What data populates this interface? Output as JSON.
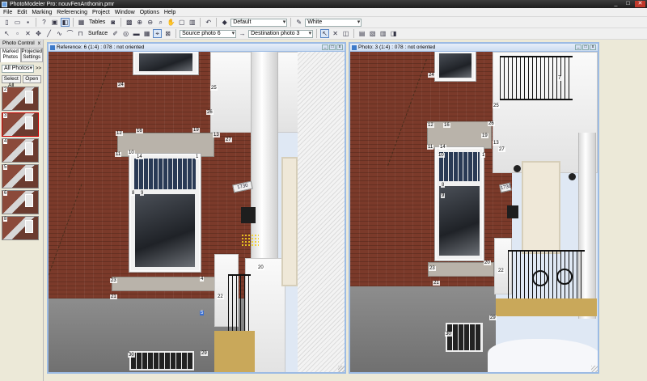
{
  "window": {
    "title": "PhotoModeler Pro: nouvFenAnthonin.pmr",
    "controls": [
      "_",
      "□",
      "✕"
    ]
  },
  "menu": [
    "File",
    "Edit",
    "Marking",
    "Referencing",
    "Project",
    "Window",
    "Options",
    "Help"
  ],
  "toolbar1": {
    "tables_label": "Tables",
    "default_combo": "Default",
    "white_combo": "White"
  },
  "toolbar2": {
    "surface_label": "Surface",
    "source_photo": "Source photo 6",
    "destination_photo": "Destination photo 3"
  },
  "left_panel": {
    "title": "Photo Control",
    "close": "x",
    "tabs": [
      "Marked Photos",
      "Projected Settings"
    ],
    "filter": "All Photos",
    "filter_arrow": ">>",
    "buttons": [
      "Select All",
      "Open"
    ],
    "thumbnails": [
      "2",
      "3",
      "4",
      "5",
      "6",
      "8"
    ]
  },
  "photo_left": {
    "title": "Reference: 6 (1:4) : 078 : not oriented",
    "plaque": "1730",
    "points": [
      "24",
      "25",
      "26",
      "12",
      "16",
      "19",
      "13",
      "27",
      "11",
      "10",
      "14",
      "1",
      "8",
      "9",
      "20",
      "4",
      "23",
      "22",
      "21",
      "30",
      "29",
      "5"
    ]
  },
  "photo_right": {
    "title": "Photo: 3 (1:4) : 078 : not oriented",
    "plaque": "1730",
    "points": [
      "24",
      "25",
      "26",
      "12",
      "16",
      "19",
      "13",
      "27",
      "11",
      "14",
      "1",
      "10",
      "8",
      "9",
      "7",
      "22",
      "23",
      "21",
      "20",
      "30",
      "29"
    ]
  }
}
